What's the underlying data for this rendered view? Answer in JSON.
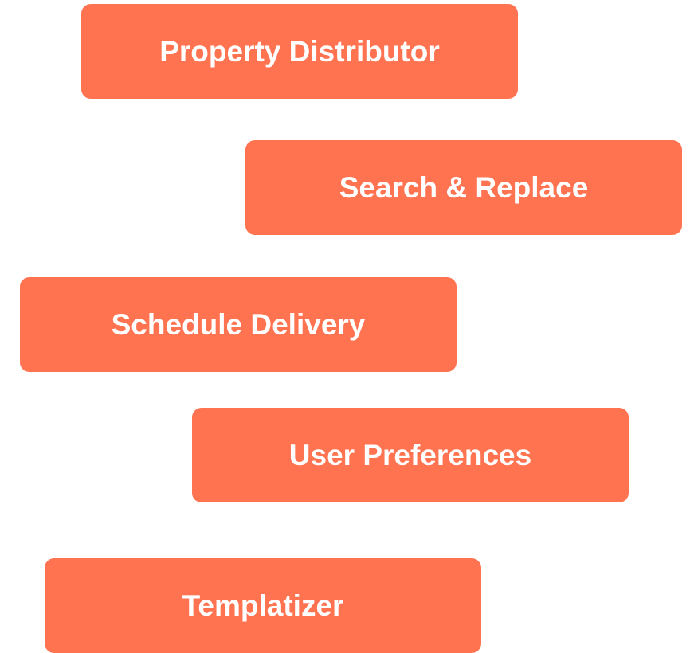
{
  "colors": {
    "button_background": "#ff7351",
    "button_text": "#ffffff",
    "page_background": "#ffffff"
  },
  "buttons": [
    {
      "label": "Property Distributor"
    },
    {
      "label": "Search & Replace"
    },
    {
      "label": "Schedule Delivery"
    },
    {
      "label": "User Preferences"
    },
    {
      "label": "Templatizer"
    }
  ]
}
